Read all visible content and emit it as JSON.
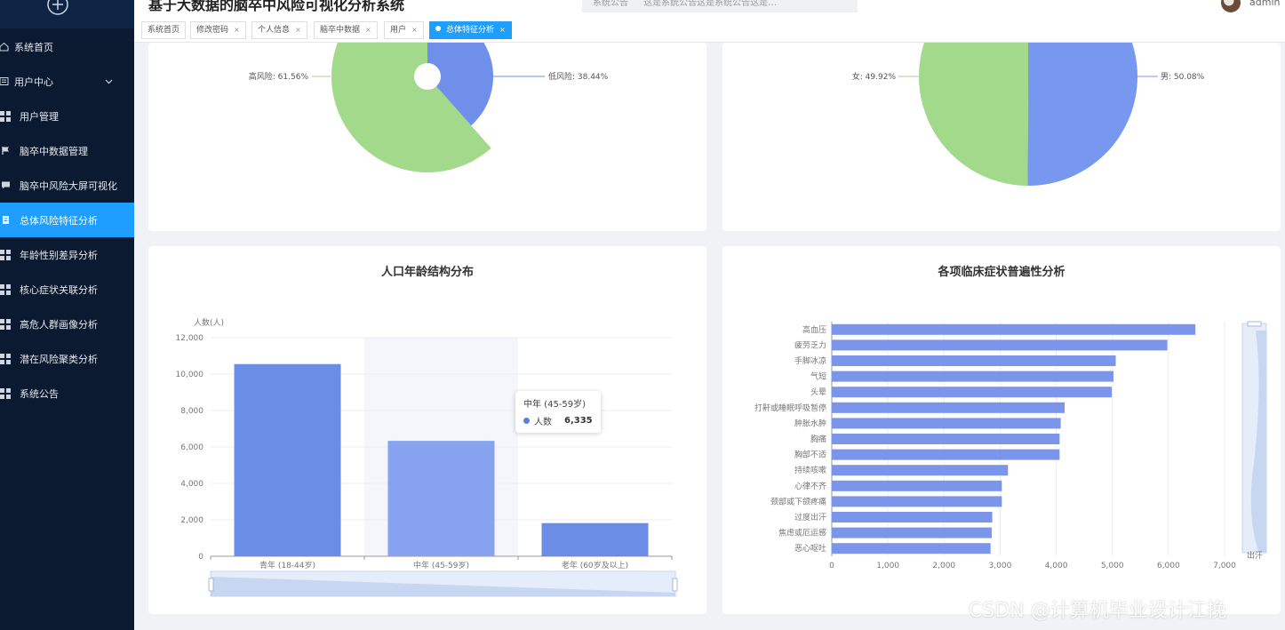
{
  "header": {
    "title": "基于大数据的脑卒中风险可视化分析系统",
    "notice_label": "系统公告",
    "notice_text": "这是系统公告这是系统公告这是…",
    "username": "admin"
  },
  "sidebar": {
    "items": [
      {
        "label": "系统首页",
        "icon": "home-icon"
      },
      {
        "label": "用户中心",
        "icon": "list-icon"
      },
      {
        "label": "用户管理",
        "icon": "grid-icon"
      },
      {
        "label": "脑卒中数据管理",
        "icon": "flag-icon"
      },
      {
        "label": "脑卒中风险大屏可视化",
        "icon": "comment-icon"
      },
      {
        "label": "总体风险特征分析",
        "icon": "document-icon",
        "active": true
      },
      {
        "label": "年龄性别差异分析",
        "icon": "grid-icon"
      },
      {
        "label": "核心症状关联分析",
        "icon": "grid-icon"
      },
      {
        "label": "高危人群画像分析",
        "icon": "grid-icon"
      },
      {
        "label": "潜在风险聚类分析",
        "icon": "grid-icon"
      },
      {
        "label": "系统公告",
        "icon": "grid-icon"
      }
    ]
  },
  "tabs": [
    {
      "label": "系统首页"
    },
    {
      "label": "修改密码",
      "close": "×"
    },
    {
      "label": "个人信息",
      "close": "×"
    },
    {
      "label": "脑卒中数据",
      "close": "×"
    },
    {
      "label": "用户",
      "close": "×"
    },
    {
      "label": "总体特征分析",
      "close": "×",
      "active": true
    }
  ],
  "pie_risk": {
    "labels": [
      "高风险: 61.56%",
      "低风险: 38.44%"
    ]
  },
  "pie_gender": {
    "labels": [
      "女: 49.92%",
      "男: 50.08%"
    ]
  },
  "chart_data": [
    {
      "type": "pie",
      "slices": [
        {
          "name": "高风险",
          "value": 61.56,
          "color": "#a3d98a"
        },
        {
          "name": "低风险",
          "value": 38.44,
          "color": "#6f8fea"
        }
      ]
    },
    {
      "type": "pie",
      "slices": [
        {
          "name": "女",
          "value": 49.92,
          "color": "#a3d98a"
        },
        {
          "name": "男",
          "value": 50.08,
          "color": "#7898ef"
        }
      ]
    },
    {
      "type": "bar",
      "title": "人口年龄结构分布",
      "ylabel": "人数(人)",
      "categories": [
        "青年 (18-44岁)",
        "中年 (45-59岁)",
        "老年 (60岁及以上)"
      ],
      "values": [
        10550,
        6335,
        1820
      ],
      "ylim": [
        0,
        12000
      ],
      "yticks": [
        "0",
        "2,000",
        "4,000",
        "6,000",
        "8,000",
        "10,000",
        "12,000"
      ],
      "color": "#6c8de6",
      "highlight_color": "#87a3ef",
      "tooltip": {
        "title": "中年 (45-59岁)",
        "series": "人数",
        "value": "6,335"
      }
    },
    {
      "type": "bar",
      "orientation": "horizontal",
      "title": "各项临床症状普遍性分析",
      "categories": [
        "高血压",
        "疲劳乏力",
        "手脚冰凉",
        "气短",
        "头晕",
        "打鼾或睡眠呼吸暂停",
        "肿胀水肿",
        "胸痛",
        "胸部不适",
        "持续咳嗽",
        "心律不齐",
        "颈部或下颌疼痛",
        "过度出汗",
        "焦虑或厄运感",
        "恶心呕吐"
      ],
      "values": [
        6480,
        5980,
        5060,
        5020,
        4990,
        4150,
        4080,
        4060,
        4060,
        3140,
        3030,
        3030,
        2860,
        2850,
        2830
      ],
      "xlim": [
        0,
        7000
      ],
      "xticks": [
        "0",
        "1,000",
        "2,000",
        "3,000",
        "4,000",
        "5,000",
        "6,000",
        "7,000"
      ],
      "color": "#7b95ea",
      "slider_label": "出汗"
    }
  ],
  "watermark": "CSDN @计算机毕业设计江挽"
}
